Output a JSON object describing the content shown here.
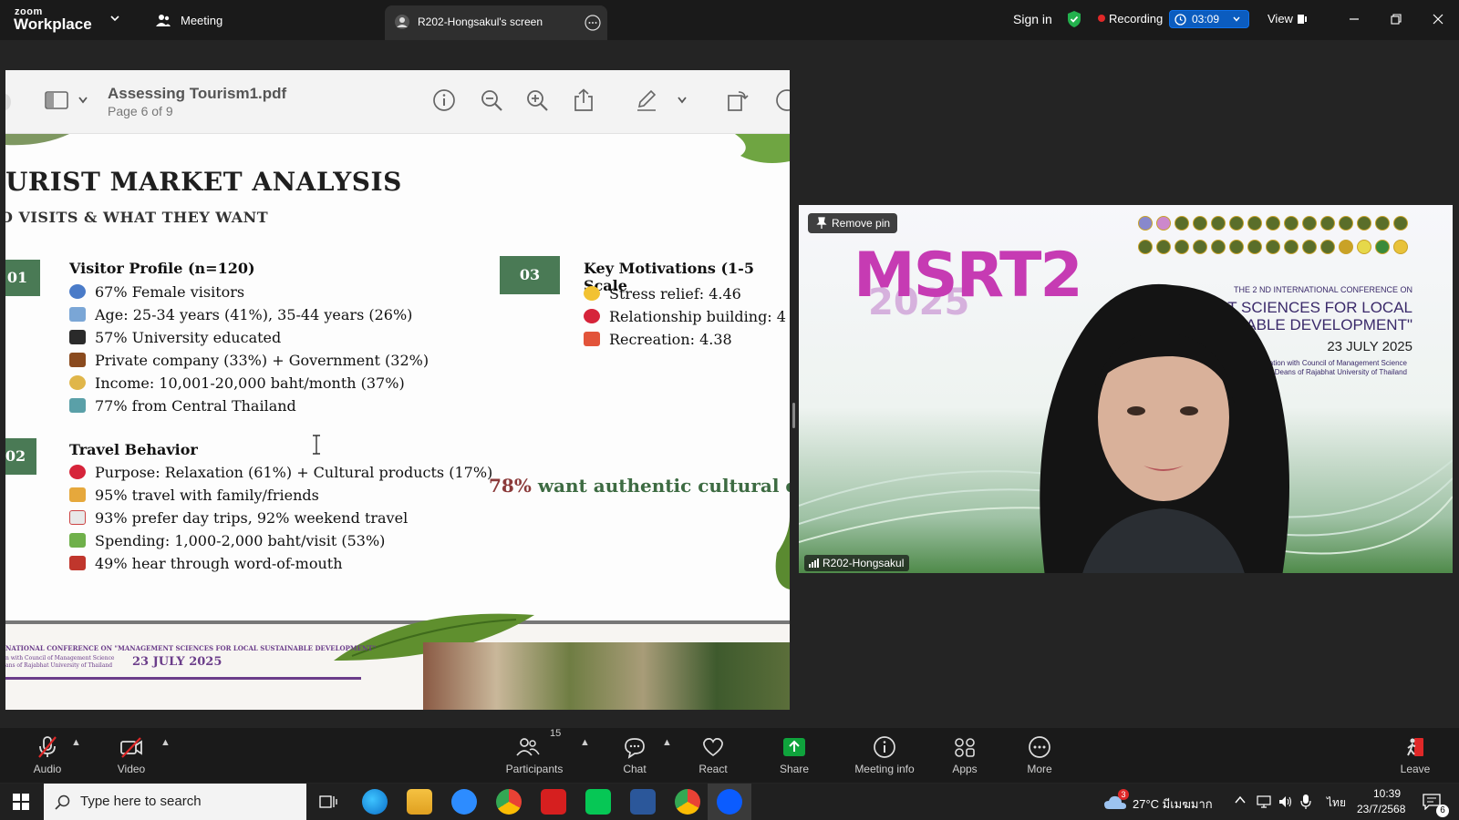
{
  "topbar": {
    "logo_line1": "zoom",
    "logo_line2": "Workplace",
    "meeting_label": "Meeting",
    "screen_tab_label": "R202-Hongsakul's screen",
    "sign_in": "Sign in",
    "recording_label": "Recording",
    "timer": "03:09",
    "view_label": "View"
  },
  "pdf": {
    "title": "Assessing Tourism1.pdf",
    "page_info": "Page 6 of 9"
  },
  "slide": {
    "heading": "URIST MARKET ANALYSIS",
    "subheading": "O VISITS & WHAT THEY WANT",
    "sec1_num": "01",
    "sec1_title": "Visitor Profile (n=120)",
    "sec1_items": [
      "67% Female visitors",
      "Age: 25-34 years (41%), 35-44 years (26%)",
      "57% University educated",
      "Private company (33%) + Government (32%)",
      "Income: 10,001-20,000 baht/month (37%)",
      "77% from Central Thailand"
    ],
    "sec2_num": "02",
    "sec2_title": "Travel Behavior",
    "sec2_items": [
      "Purpose: Relaxation (61%) + Cultural products (17%)",
      "95% travel with family/friends",
      "93% prefer day trips, 92% weekend travel",
      "Spending: 1,000-2,000 baht/visit (53%)",
      "49% hear through word-of-mouth"
    ],
    "sec3_num": "03",
    "sec3_title": "Key Motivations (1-5 Scale",
    "sec3_items": [
      "Stress relief: 4.46",
      "Relationship building: 4",
      "Recreation: 4.38"
    ],
    "highlight_pct": "78%",
    "highlight_text": "want authentic cultural ex",
    "footer_conf": "NATIONAL CONFERENCE ON \"MANAGEMENT SCIENCES FOR LOCAL SUSTAINABLE DEVELOPMENT\"",
    "footer_collab1": "n with Council of Management Science",
    "footer_collab2": "ans of Rajabhat University of Thailand",
    "footer_date": "23 JULY 2025"
  },
  "video": {
    "remove_pin": "Remove pin",
    "brand": "MSRT2",
    "brand_year": "2025",
    "conf_line1": "THE 2 ND INTERNATIONAL CONFERENCE ON",
    "conf_line2": "GEMENT SCIENCES FOR LOCAL",
    "conf_line3": "SUSTAINABLE DEVELOPMENT\"",
    "conf_date": "23 JULY 2025",
    "conf_collab1": "In Collaboration with Council of Management Science",
    "conf_collab2": "Deans of Rajabhat University of Thailand",
    "participant_name": "R202-Hongsakul"
  },
  "controls": {
    "audio": "Audio",
    "video": "Video",
    "participants": "Participants",
    "participants_count": "15",
    "chat": "Chat",
    "react": "React",
    "share": "Share",
    "meeting_info": "Meeting info",
    "apps": "Apps",
    "more": "More",
    "leave": "Leave"
  },
  "taskbar": {
    "search_placeholder": "Type here to search",
    "weather": "27°C มีเมฆมาก",
    "weather_badge": "3",
    "language": "ไทย",
    "time": "10:39",
    "date": "23/7/2568",
    "notification_count": "6"
  },
  "colors": {
    "slide_green": "#4a7a55",
    "recording_red": "#e02828",
    "zoom_blue": "#0e71eb",
    "share_green": "#0fa33c",
    "leave_red": "#e02828",
    "brand_magenta": "#c63bb3"
  }
}
